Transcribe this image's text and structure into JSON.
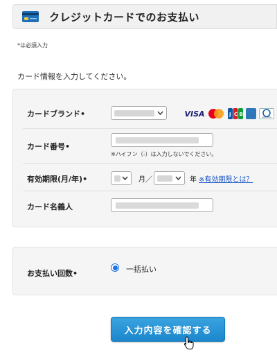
{
  "header": {
    "title": "クレジットカードでのお支払い",
    "icon": "credit-card-icon"
  },
  "required_note": "*は必須入力",
  "intro": "カード情報を入力してください。",
  "card_form": {
    "brand": {
      "label": "カードブランド",
      "selected": "",
      "logos": [
        "VISA",
        "Mastercard",
        "JCB",
        "AMEX",
        "Diners Club"
      ]
    },
    "number": {
      "label": "カード番号",
      "value": "",
      "hint": "※ハイフン（-）は入力しないでください。"
    },
    "expiry": {
      "label": "有効期限(月/年)",
      "month": "",
      "month_unit": "月／",
      "year": "",
      "year_unit": "年",
      "help_link": "※有効期限とは？"
    },
    "name": {
      "label": "カード名義人",
      "value": ""
    }
  },
  "payment": {
    "label": "お支払い回数",
    "option": "一括払い",
    "selected": true
  },
  "confirm_button": "入力内容を確認する",
  "required_mark": "•",
  "colors": {
    "accent": "#1a73e8",
    "button": "#1b86cc",
    "link": "#1a56c9"
  }
}
